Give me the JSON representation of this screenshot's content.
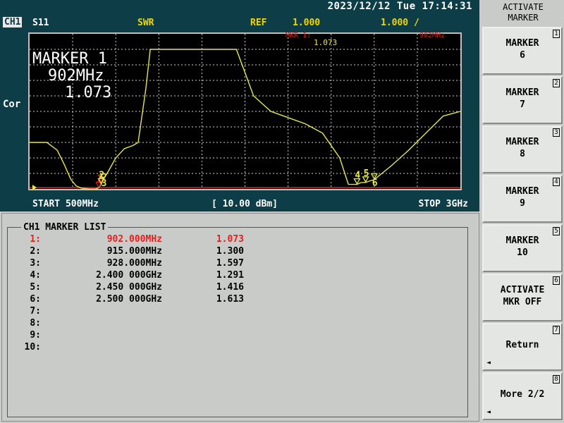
{
  "status": {
    "datetime": "2023/12/12 Tue 17:14:31"
  },
  "header": {
    "channel": "CH1",
    "param": "S11",
    "format": "SWR",
    "ref_label": "REF",
    "ref_value": "1.000",
    "scale": "1.000 /"
  },
  "graph": {
    "left_label": "Cor",
    "active_marker_title": "MARKER 1",
    "active_marker_freq": "902MHz",
    "active_marker_value": "1.073",
    "mkr_readout_label": "MKR 1:",
    "mkr_readout_value": "1.073",
    "mkr_readout_freq": "902MHz",
    "trace_color": "#e8e84a",
    "marker_labels": [
      "1",
      "2",
      "3",
      "4",
      "5",
      "6"
    ],
    "trace": [
      [
        500,
        3.0
      ],
      [
        600,
        3.0
      ],
      [
        660,
        2.5
      ],
      [
        700,
        1.6
      ],
      [
        740,
        0.6
      ],
      [
        770,
        0.2
      ],
      [
        800,
        0.05
      ],
      [
        850,
        0.0
      ],
      [
        880,
        0.0
      ],
      [
        902,
        0.073
      ],
      [
        915,
        0.3
      ],
      [
        928,
        0.6
      ],
      [
        960,
        1.2
      ],
      [
        1000,
        2.0
      ],
      [
        1050,
        2.6
      ],
      [
        1100,
        2.8
      ],
      [
        1130,
        3.0
      ],
      [
        1175,
        6.5
      ],
      [
        1200,
        9.0
      ],
      [
        1300,
        9.0
      ],
      [
        1400,
        9.0
      ],
      [
        1500,
        9.0
      ],
      [
        1600,
        9.0
      ],
      [
        1700,
        9.0
      ],
      [
        1750,
        7.5
      ],
      [
        1800,
        6.0
      ],
      [
        1900,
        5.0
      ],
      [
        2000,
        4.6
      ],
      [
        2100,
        4.2
      ],
      [
        2200,
        3.6
      ],
      [
        2300,
        2.0
      ],
      [
        2350,
        0.3
      ],
      [
        2400,
        0.29
      ],
      [
        2420,
        0.4
      ],
      [
        2440,
        0.42
      ],
      [
        2450,
        0.42
      ],
      [
        2470,
        0.5
      ],
      [
        2500,
        0.6
      ],
      [
        2600,
        1.5
      ],
      [
        2700,
        2.5
      ],
      [
        2800,
        3.6
      ],
      [
        2900,
        4.7
      ],
      [
        3000,
        5.0
      ]
    ],
    "markers": [
      {
        "n": "1",
        "f": 902,
        "v": 0.073
      },
      {
        "n": "2",
        "f": 915,
        "v": 0.3
      },
      {
        "n": "3",
        "f": 928,
        "v": 0.597
      },
      {
        "n": "4",
        "f": 2400,
        "v": 0.291
      },
      {
        "n": "5",
        "f": 2450,
        "v": 0.416
      },
      {
        "n": "6",
        "f": 2500,
        "v": 0.613
      }
    ],
    "x_range": [
      500,
      3000
    ],
    "y_range": [
      0,
      10
    ]
  },
  "footer": {
    "start": "START 500MHz",
    "power": "[ 10.00 dBm]",
    "stop": "STOP 3GHz"
  },
  "marker_list": {
    "title": "CH1 MARKER LIST",
    "rows": [
      {
        "num": "1:",
        "freq": "902.000MHz",
        "val": "1.073",
        "active": true
      },
      {
        "num": "2:",
        "freq": "915.000MHz",
        "val": "1.300"
      },
      {
        "num": "3:",
        "freq": "928.000MHz",
        "val": "1.597"
      },
      {
        "num": "4:",
        "freq": "2.400 000GHz",
        "val": "1.291"
      },
      {
        "num": "5:",
        "freq": "2.450 000GHz",
        "val": "1.416"
      },
      {
        "num": "6:",
        "freq": "2.500 000GHz",
        "val": "1.613"
      },
      {
        "num": "7:",
        "freq": "",
        "val": ""
      },
      {
        "num": "8:",
        "freq": "",
        "val": ""
      },
      {
        "num": "9:",
        "freq": "",
        "val": ""
      },
      {
        "num": "10:",
        "freq": "",
        "val": ""
      }
    ]
  },
  "softkeys": {
    "header_line1": "ACTIVATE",
    "header_line2": "MARKER",
    "keys": [
      {
        "num": "1",
        "line1": "MARKER",
        "line2": "6"
      },
      {
        "num": "2",
        "line1": "MARKER",
        "line2": "7"
      },
      {
        "num": "3",
        "line1": "MARKER",
        "line2": "8"
      },
      {
        "num": "4",
        "line1": "MARKER",
        "line2": "9"
      },
      {
        "num": "5",
        "line1": "MARKER",
        "line2": "10"
      },
      {
        "num": "6",
        "line1": "ACTIVATE",
        "line2": "MKR OFF"
      },
      {
        "num": "7",
        "line1": "Return",
        "line2": ""
      },
      {
        "num": "8",
        "line1": "More 2/2",
        "line2": ""
      }
    ]
  }
}
